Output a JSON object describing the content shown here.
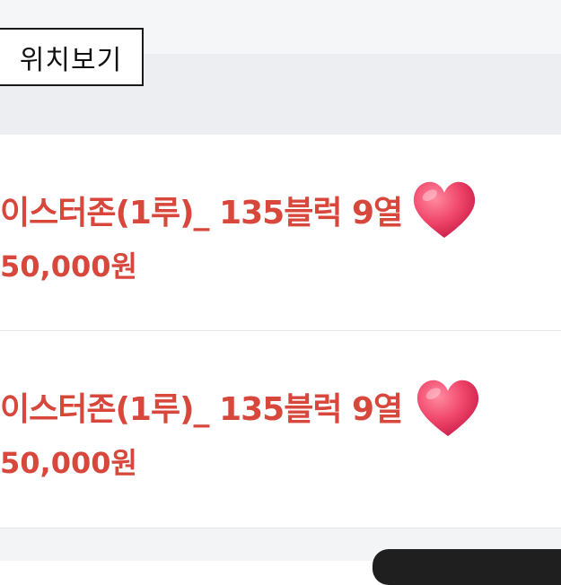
{
  "location_button": {
    "label": "위치보기"
  },
  "listings": [
    {
      "title": "이스터존(1루)_ 135블럭 9열",
      "price": "50,000원",
      "icon": "heart-icon"
    },
    {
      "title": "이스터존(1루)_ 135블럭 9열",
      "price": "50,000원",
      "icon": "heart-icon"
    }
  ],
  "colors": {
    "accent": "#d8473c",
    "heart": "#f0466a",
    "background": "#ffffff",
    "band": "#eceef1"
  }
}
